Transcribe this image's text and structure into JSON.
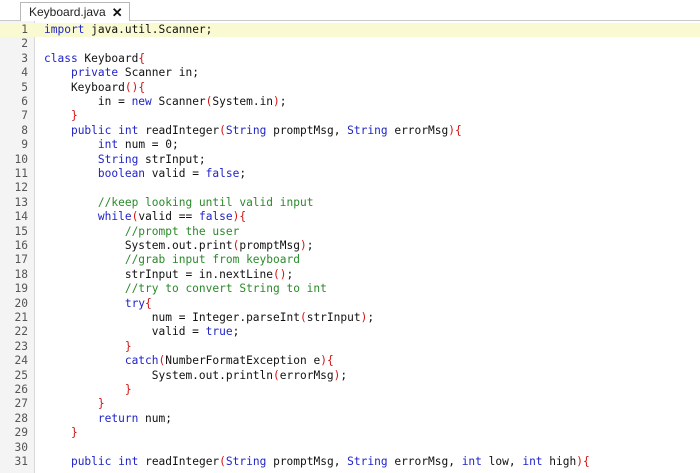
{
  "tab": {
    "title": "Keyboard.java",
    "close_glyph": "✕"
  },
  "colors": {
    "keyword": "#1f24c8",
    "comment": "#2a8a2a",
    "brace": "#d11515",
    "current_line": "#fafad2"
  },
  "lines": [
    {
      "n": "1",
      "t": "import java.util.Scanner;"
    },
    {
      "n": "2",
      "t": ""
    },
    {
      "n": "3",
      "t": "class Keyboard{"
    },
    {
      "n": "4",
      "t": "    private Scanner in;"
    },
    {
      "n": "5",
      "t": "    Keyboard(){"
    },
    {
      "n": "6",
      "t": "        in = new Scanner(System.in);"
    },
    {
      "n": "7",
      "t": "    }"
    },
    {
      "n": "8",
      "t": "    public int readInteger(String promptMsg, String errorMsg){"
    },
    {
      "n": "9",
      "t": "        int num = 0;"
    },
    {
      "n": "10",
      "t": "        String strInput;"
    },
    {
      "n": "11",
      "t": "        boolean valid = false;"
    },
    {
      "n": "12",
      "t": ""
    },
    {
      "n": "13",
      "t": "        //keep looking until valid input"
    },
    {
      "n": "14",
      "t": "        while(valid == false){"
    },
    {
      "n": "15",
      "t": "            //prompt the user"
    },
    {
      "n": "16",
      "t": "            System.out.print(promptMsg);"
    },
    {
      "n": "17",
      "t": "            //grab input from keyboard"
    },
    {
      "n": "18",
      "t": "            strInput = in.nextLine();"
    },
    {
      "n": "19",
      "t": "            //try to convert String to int"
    },
    {
      "n": "20",
      "t": "            try{"
    },
    {
      "n": "21",
      "t": "                num = Integer.parseInt(strInput);"
    },
    {
      "n": "22",
      "t": "                valid = true;"
    },
    {
      "n": "23",
      "t": "            }"
    },
    {
      "n": "24",
      "t": "            catch(NumberFormatException e){"
    },
    {
      "n": "25",
      "t": "                System.out.println(errorMsg);"
    },
    {
      "n": "26",
      "t": "            }"
    },
    {
      "n": "27",
      "t": "        }"
    },
    {
      "n": "28",
      "t": "        return num;"
    },
    {
      "n": "29",
      "t": "    }"
    },
    {
      "n": "30",
      "t": ""
    },
    {
      "n": "31",
      "t": "    public int readInteger(String promptMsg, String errorMsg, int low, int high){"
    }
  ]
}
